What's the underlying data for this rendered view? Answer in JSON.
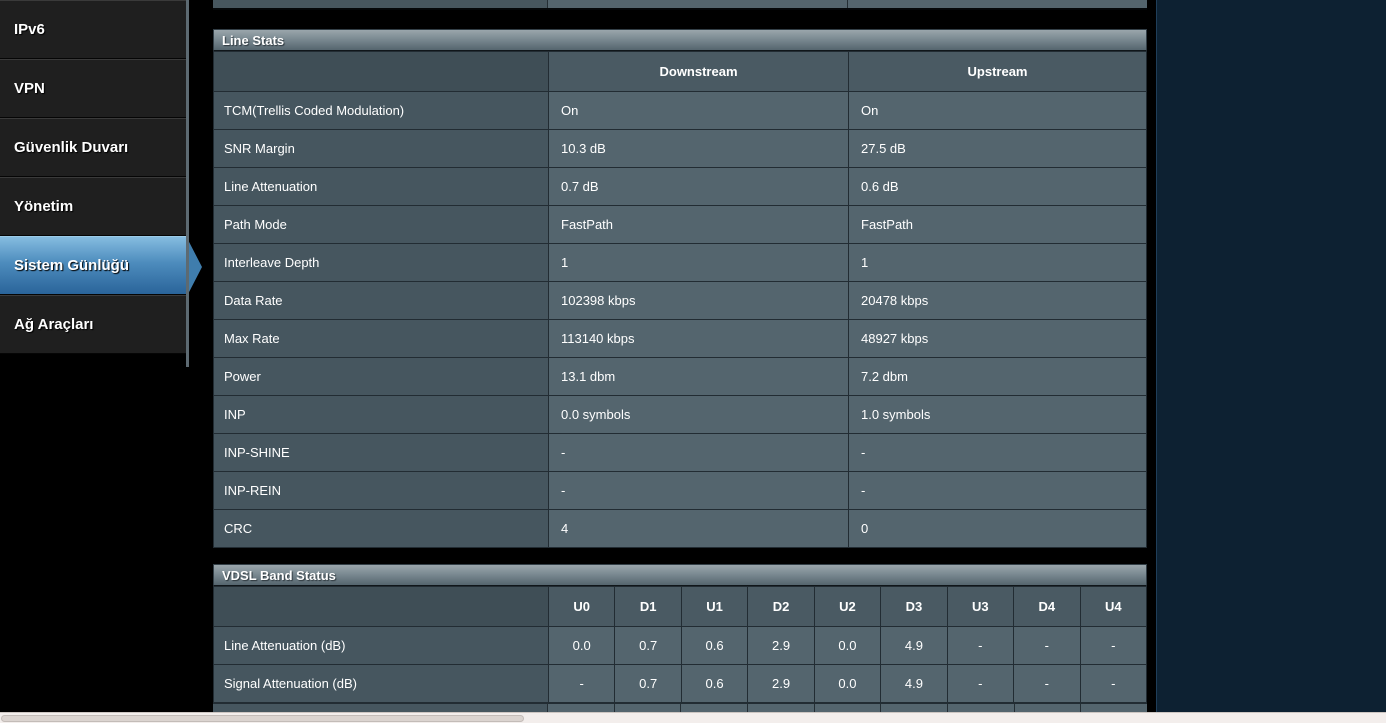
{
  "sidebar": {
    "items": [
      {
        "label": "IPv6",
        "selected": false
      },
      {
        "label": "VPN",
        "selected": false
      },
      {
        "label": "Güvenlik Duvarı",
        "selected": false
      },
      {
        "label": "Yönetim",
        "selected": false
      },
      {
        "label": "Sistem Günlüğü",
        "selected": true
      },
      {
        "label": "Ağ Araçları",
        "selected": false
      }
    ]
  },
  "line_stats": {
    "title": "Line Stats",
    "columns": [
      "",
      "Downstream",
      "Upstream"
    ],
    "rows": [
      {
        "label": "TCM(Trellis Coded Modulation)",
        "downstream": "On",
        "upstream": "On"
      },
      {
        "label": "SNR Margin",
        "downstream": "10.3 dB",
        "upstream": "27.5 dB"
      },
      {
        "label": "Line Attenuation",
        "downstream": "0.7 dB",
        "upstream": "0.6 dB"
      },
      {
        "label": "Path Mode",
        "downstream": "FastPath",
        "upstream": "FastPath"
      },
      {
        "label": "Interleave Depth",
        "downstream": "1",
        "upstream": "1"
      },
      {
        "label": "Data Rate",
        "downstream": "102398 kbps",
        "upstream": "20478 kbps"
      },
      {
        "label": "Max Rate",
        "downstream": "113140 kbps",
        "upstream": "48927 kbps"
      },
      {
        "label": "Power",
        "downstream": "13.1 dbm",
        "upstream": "7.2 dbm"
      },
      {
        "label": "INP",
        "downstream": "0.0 symbols",
        "upstream": "1.0 symbols"
      },
      {
        "label": "INP-SHINE",
        "downstream": "-",
        "upstream": "-"
      },
      {
        "label": "INP-REIN",
        "downstream": "-",
        "upstream": "-"
      },
      {
        "label": "CRC",
        "downstream": "4",
        "upstream": "0"
      }
    ]
  },
  "vdsl_band_status": {
    "title": "VDSL Band Status",
    "columns": [
      "",
      "U0",
      "D1",
      "U1",
      "D2",
      "U2",
      "D3",
      "U3",
      "D4",
      "U4"
    ],
    "rows": [
      {
        "label": "Line Attenuation (dB)",
        "values": [
          "0.0",
          "0.7",
          "0.6",
          "2.9",
          "0.0",
          "4.9",
          "-",
          "-",
          "-"
        ]
      },
      {
        "label": "Signal Attenuation (dB)",
        "values": [
          "-",
          "0.7",
          "0.6",
          "2.9",
          "0.0",
          "4.9",
          "-",
          "-",
          "-"
        ]
      }
    ]
  },
  "colors": {
    "upstream_value": "#4cc1ec",
    "downstream_value": "#dfa32e",
    "selected_menu_top": "#85bce0",
    "selected_menu_bottom": "#2a649a"
  }
}
